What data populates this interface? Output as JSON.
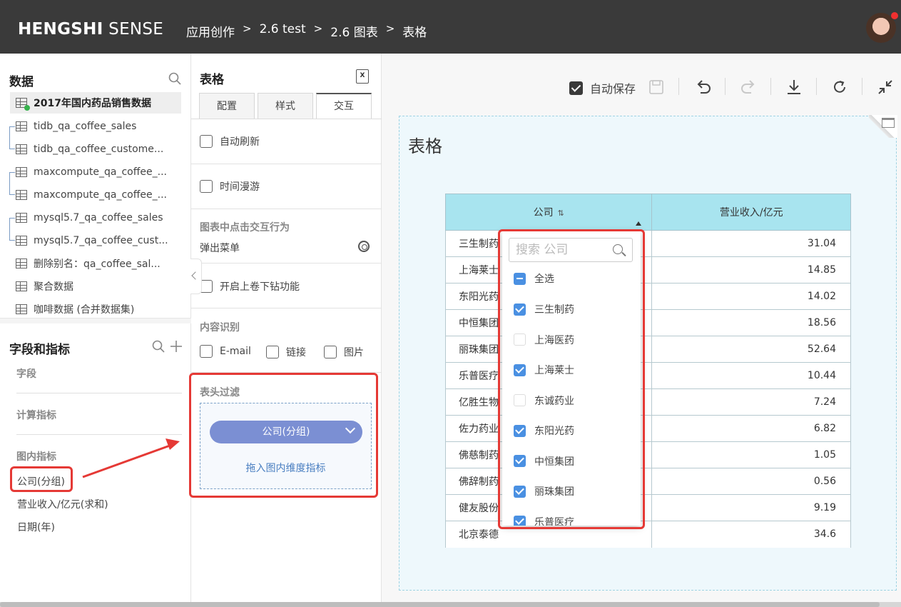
{
  "app": {
    "logo_bold": "HENGSHI",
    "logo_thin": " SENSE",
    "breadcrumb": [
      "应用创作",
      "2.6 test",
      "2.6 图表",
      "表格"
    ],
    "breadcrumb_sep": ">"
  },
  "data_panel": {
    "title": "数据",
    "datasets": [
      "2017年国内药品销售数据",
      "tidb_qa_coffee_sales",
      "tidb_qa_coffee_custome...",
      "maxcompute_qa_coffee_...",
      "maxcompute_qa_coffee_...",
      "mysql5.7_qa_coffee_sales",
      "mysql5.7_qa_coffee_cust...",
      "删除别名：qa_coffee_sal...",
      "聚合数据",
      "咖啡数据 (合并数据集)"
    ]
  },
  "fields_panel": {
    "title": "字段和指标",
    "sections": [
      "字段",
      "计算指标",
      "图内指标"
    ],
    "chart_fields": [
      "公司(分组)",
      "营业收入/亿元(求和)",
      "日期(年)"
    ]
  },
  "config_panel": {
    "title": "表格",
    "tabs": [
      "配置",
      "样式",
      "交互"
    ],
    "auto_refresh": "自动刷新",
    "time_roam": "时间漫游",
    "click_behavior_title": "图表中点击交互行为",
    "click_behavior_value": "弹出菜单",
    "drill_label": "开启上卷下钻功能",
    "content_recog_title": "内容识别",
    "content_recog_options": [
      "E-mail",
      "链接",
      "图片"
    ],
    "header_filter_title": "表头过滤",
    "filter_pill": "公司(分组)",
    "drop_hint": "拖入图内维度指标"
  },
  "toolbar": {
    "autosave_label": "自动保存"
  },
  "chart": {
    "title": "表格",
    "columns": [
      "公司",
      "营业收入/亿元"
    ],
    "rows": [
      [
        "三生制药",
        "31.04"
      ],
      [
        "上海莱士",
        "14.85"
      ],
      [
        "东阳光药",
        "14.02"
      ],
      [
        "中恒集团",
        "18.56"
      ],
      [
        "丽珠集团",
        "52.64"
      ],
      [
        "乐普医疗",
        "10.44"
      ],
      [
        "亿胜生物",
        "7.24"
      ],
      [
        "佐力药业",
        "6.82"
      ],
      [
        "佛慈制药",
        "1.05"
      ],
      [
        "佛辞制药",
        "0.56"
      ],
      [
        "健友股份",
        "9.19"
      ],
      [
        "北京泰德",
        "34.6"
      ]
    ]
  },
  "filter_popup": {
    "search_placeholder": "搜索 公司",
    "select_all": "全选",
    "options": [
      {
        "label": "三生制药",
        "checked": true
      },
      {
        "label": "上海医药",
        "checked": false
      },
      {
        "label": "上海莱士",
        "checked": true
      },
      {
        "label": "东诚药业",
        "checked": false
      },
      {
        "label": "东阳光药",
        "checked": true
      },
      {
        "label": "中恒集团",
        "checked": true
      },
      {
        "label": "丽珠集团",
        "checked": true
      },
      {
        "label": "乐普医疗",
        "checked": true
      }
    ]
  },
  "colors": {
    "header_bg": "#3a3a3a",
    "table_header": "#a8e4ef",
    "canvas_bg": "#eef8fc",
    "pill": "#7b8fd3",
    "checkbox_blue": "#4a90e2",
    "highlight_red": "#e53935"
  }
}
